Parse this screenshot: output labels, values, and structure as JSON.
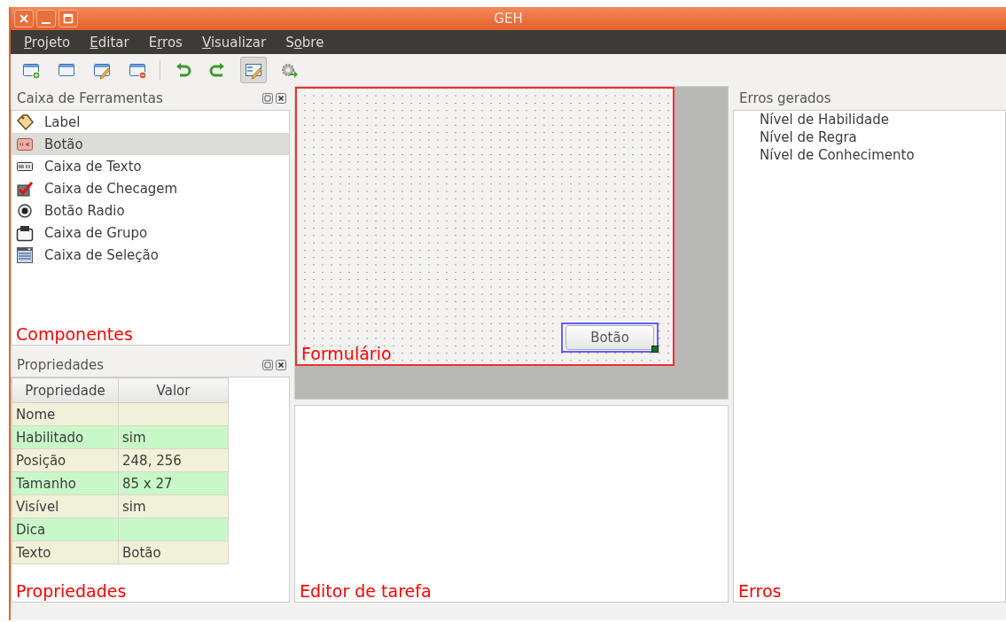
{
  "window": {
    "title": "GEH"
  },
  "menu": [
    {
      "mnemonic": "P",
      "rest": "rojeto"
    },
    {
      "mnemonic": "E",
      "rest": "ditar"
    },
    {
      "lead": "E",
      "mnemonic": "r",
      "rest": "ros"
    },
    {
      "mnemonic": "V",
      "rest": "isualizar"
    },
    {
      "lead": "S",
      "mnemonic": "o",
      "rest": "bre"
    }
  ],
  "toolbar": {
    "groups": [
      [
        {
          "selected": false
        },
        {
          "selected": false
        },
        {
          "selected": false
        },
        {
          "selected": false
        }
      ],
      [
        {
          "selected": false
        },
        {
          "selected": false
        },
        {
          "selected": true
        },
        {
          "selected": false
        }
      ]
    ]
  },
  "toolbox": {
    "title": "Caixa de Ferramentas",
    "annotation": "Componentes",
    "items": [
      {
        "label": "Label",
        "selected": false
      },
      {
        "label": "Botão",
        "selected": true
      },
      {
        "label": "Caixa de Texto",
        "selected": false
      },
      {
        "label": "Caixa de Checagem",
        "selected": false
      },
      {
        "label": "Botão Radio",
        "selected": false
      },
      {
        "label": "Caixa de Grupo",
        "selected": false
      },
      {
        "label": "Caixa de Seleção",
        "selected": false
      }
    ]
  },
  "properties": {
    "title": "Propriedades",
    "annotation": "Propriedades",
    "columns": [
      "Propriedade",
      "Valor"
    ],
    "rows": [
      [
        "Nome",
        ""
      ],
      [
        "Habilitado",
        "sim"
      ],
      [
        "Posição",
        "248, 256"
      ],
      [
        "Tamanho",
        "85 x 27"
      ],
      [
        "Visível",
        "sim"
      ],
      [
        "Dica",
        ""
      ],
      [
        "Texto",
        "Botão"
      ]
    ]
  },
  "form": {
    "annotation": "Formulário",
    "widget": {
      "label": "Botão",
      "selected": true
    }
  },
  "task_editor": {
    "annotation": "Editor de tarefa"
  },
  "errors": {
    "title": "Erros gerados",
    "annotation": "Erros",
    "items": [
      "Nível de Habilidade",
      "Nível de Regra",
      "Nível de Conhecimento"
    ]
  }
}
